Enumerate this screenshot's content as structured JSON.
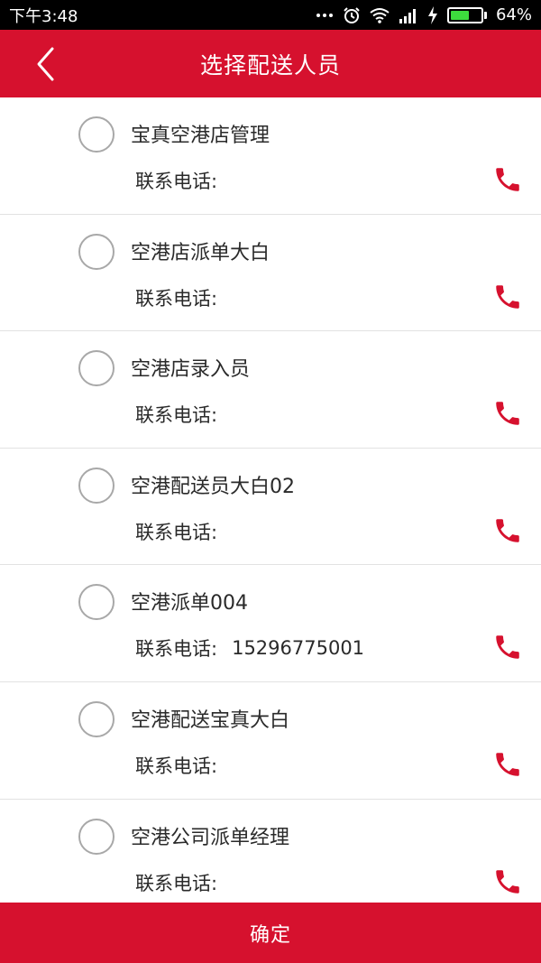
{
  "status_bar": {
    "time": "下午3:48",
    "battery_percent": "64%",
    "battery_level": 0.64,
    "icons": [
      "more-dots-icon",
      "alarm-clock-icon",
      "wifi-icon",
      "signal-bars-icon",
      "charging-bolt-icon",
      "battery-icon"
    ]
  },
  "header": {
    "title": "选择配送人员",
    "back_icon": "chevron-left-icon"
  },
  "delivery_list": [
    {
      "name": "宝真空港店管理",
      "phone_label": "联系电话:",
      "phone": "",
      "selected": false
    },
    {
      "name": "空港店派单大白",
      "phone_label": "联系电话:",
      "phone": "",
      "selected": false
    },
    {
      "name": "空港店录入员",
      "phone_label": "联系电话:",
      "phone": "",
      "selected": false
    },
    {
      "name": "空港配送员大白02",
      "phone_label": "联系电话:",
      "phone": "",
      "selected": false
    },
    {
      "name": "空港派单004",
      "phone_label": "联系电话:",
      "phone": "15296775001",
      "selected": false
    },
    {
      "name": "空港配送宝真大白",
      "phone_label": "联系电话:",
      "phone": "",
      "selected": false
    },
    {
      "name": "空港公司派单经理",
      "phone_label": "联系电话:",
      "phone": "",
      "selected": false
    }
  ],
  "footer": {
    "confirm_label": "确定"
  },
  "colors": {
    "brand_red": "#d6112e",
    "phone_icon": "#d6112e",
    "battery_green": "#3ddc3d"
  }
}
